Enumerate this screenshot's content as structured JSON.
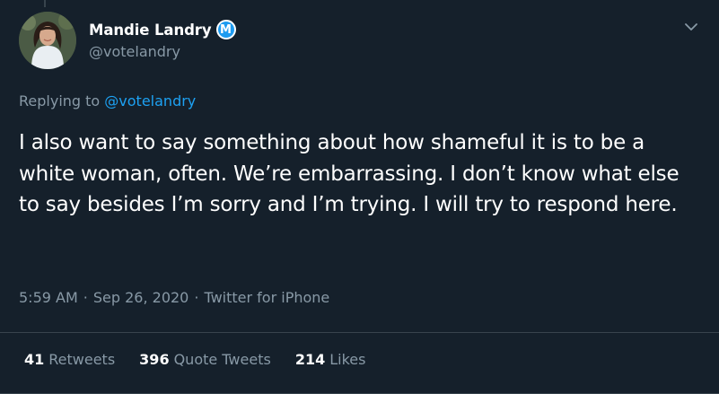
{
  "author": {
    "display_name": "Mandie Landry",
    "handle": "@votelandry",
    "badge_letter": "M"
  },
  "reply": {
    "prefix": "Replying to",
    "mention": "@votelandry"
  },
  "tweet": {
    "text": "I also want to say something about how shameful it is to be a white woman, often. We’re embarrassing. I don’t know what else to say besides I’m sorry and I’m trying. I will try to respond here."
  },
  "meta": {
    "time": "5:59 AM",
    "separator1": "·",
    "date": "Sep 26, 2020",
    "separator2": "·",
    "source": "Twitter for iPhone"
  },
  "stats": {
    "retweets_count": "41",
    "retweets_label": "Retweets",
    "quotes_count": "396",
    "quotes_label": "Quote Tweets",
    "likes_count": "214",
    "likes_label": "Likes"
  },
  "icons": {
    "menu": "chevron-down-icon",
    "badge": "verified-badge-icon",
    "avatar": "profile-photo"
  },
  "colors": {
    "background": "#15202b",
    "text_primary": "#ffffff",
    "text_secondary": "#8899a6",
    "accent": "#1da1f2",
    "divider": "#38444d"
  }
}
